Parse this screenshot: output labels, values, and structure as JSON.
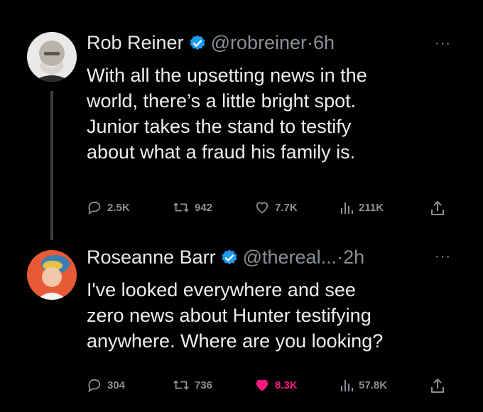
{
  "tweets": [
    {
      "name": "Rob Reiner",
      "handle": "@robreiner",
      "time": "·6h",
      "more": "···",
      "text": "With all the upsetting news in the\nworld, there’s a little bright spot.\nJunior takes the stand to testify\nabout what a fraud his family is.",
      "replies": "2.5K",
      "retweets": "942",
      "likes": "7.7K",
      "views": "211K",
      "liked": false
    },
    {
      "name": "Roseanne Barr",
      "handle": "@thereal...",
      "time": "·2h",
      "more": "···",
      "text": "I've looked everywhere and see\nzero news about Hunter testifying\nanywhere. Where are you looking?",
      "replies": "304",
      "retweets": "736",
      "likes": "8.3K",
      "views": "57.8K",
      "liked": true
    }
  ],
  "colors": {
    "background": "#000000",
    "text": "#e7e9ea",
    "muted": "#8b9095",
    "verified": "#1d9bf0",
    "like": "#f91880"
  }
}
